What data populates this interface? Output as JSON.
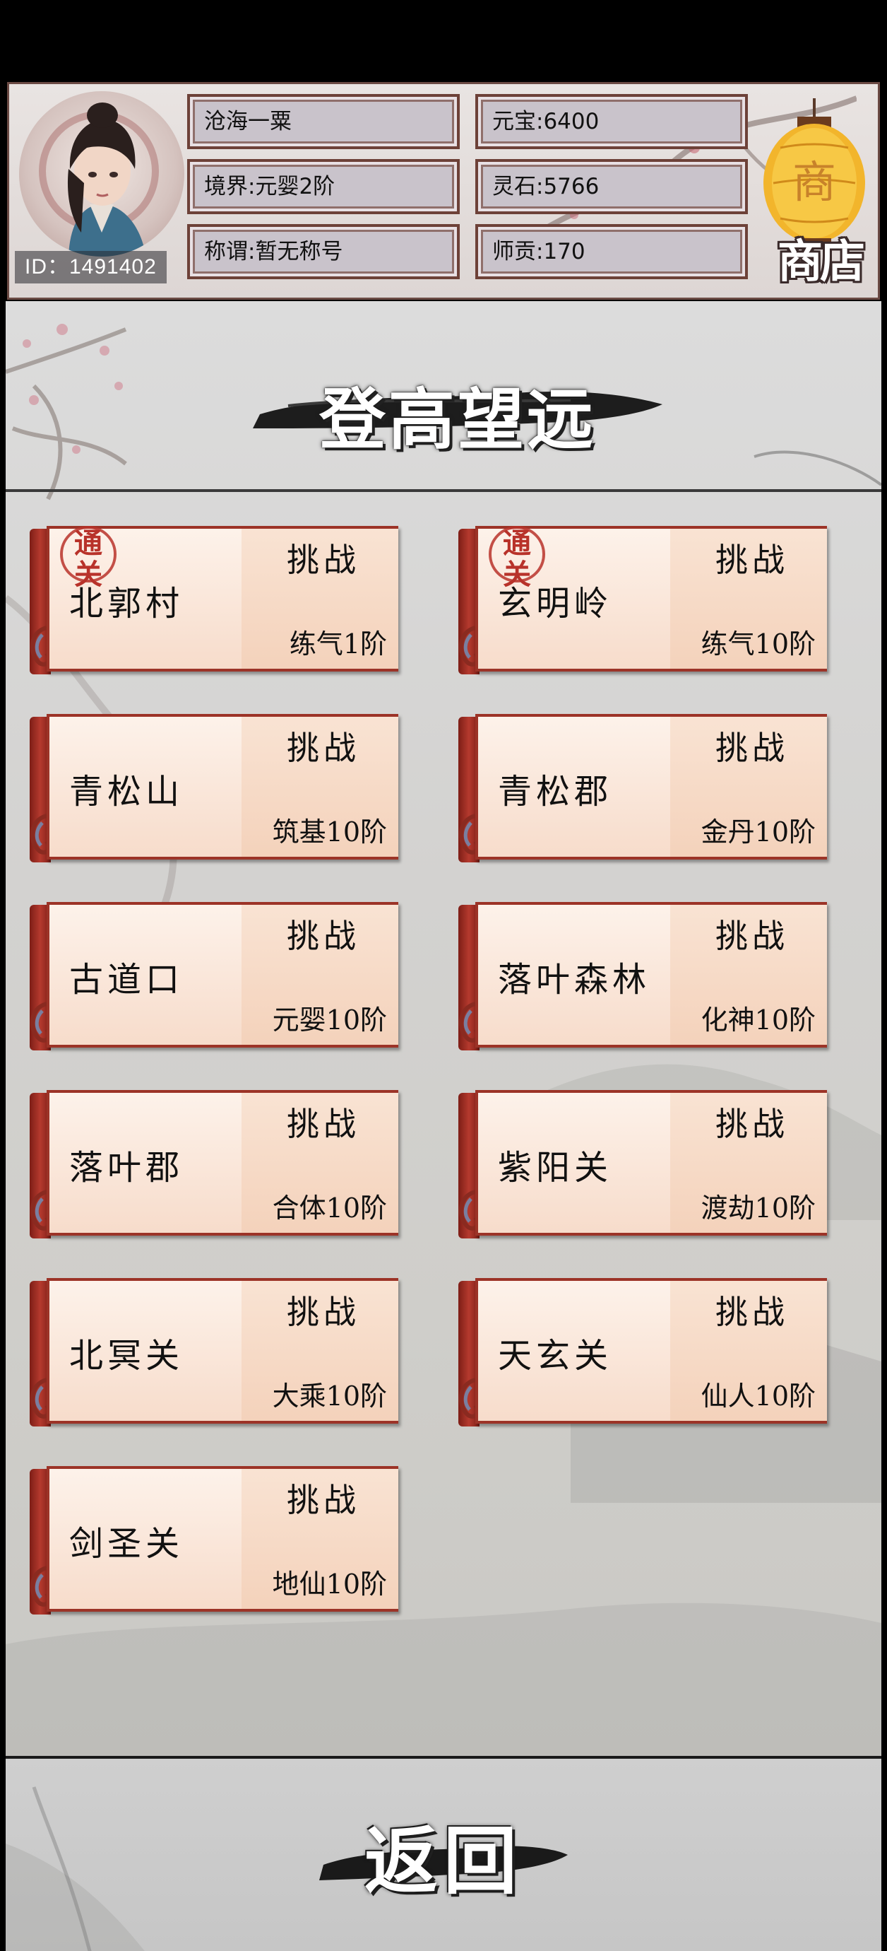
{
  "header": {
    "player_name": "沧海一粟",
    "realm": "境界:元婴2阶",
    "title": "称谓:暂无称号",
    "yuanbao": "元宝:6400",
    "lingshi": "灵石:5766",
    "shigong": "师贡:170",
    "player_id": "ID：1491402",
    "shop_label": "商店",
    "lantern_char": "商"
  },
  "page_title": "登高望远",
  "stages": [
    {
      "name": "北郭村",
      "action": "挑战",
      "requirement": "练气1阶",
      "cleared": true
    },
    {
      "name": "玄明岭",
      "action": "挑战",
      "requirement": "练气10阶",
      "cleared": true
    },
    {
      "name": "青松山",
      "action": "挑战",
      "requirement": "筑基10阶",
      "cleared": false
    },
    {
      "name": "青松郡",
      "action": "挑战",
      "requirement": "金丹10阶",
      "cleared": false
    },
    {
      "name": "古道口",
      "action": "挑战",
      "requirement": "元婴10阶",
      "cleared": false
    },
    {
      "name": "落叶森林",
      "action": "挑战",
      "requirement": "化神10阶",
      "cleared": false
    },
    {
      "name": "落叶郡",
      "action": "挑战",
      "requirement": "合体10阶",
      "cleared": false
    },
    {
      "name": "紫阳关",
      "action": "挑战",
      "requirement": "渡劫10阶",
      "cleared": false
    },
    {
      "name": "北冥关",
      "action": "挑战",
      "requirement": "大乘10阶",
      "cleared": false
    },
    {
      "name": "天玄关",
      "action": "挑战",
      "requirement": "仙人10阶",
      "cleared": false
    },
    {
      "name": "剑圣关",
      "action": "挑战",
      "requirement": "地仙10阶",
      "cleared": false
    }
  ],
  "seal_text": "通关",
  "back_label": "返回",
  "colors": {
    "card_border": "#9c3327",
    "spine": "#b53a2e",
    "seal": "#b8322a",
    "lantern": "#f2b52c"
  }
}
